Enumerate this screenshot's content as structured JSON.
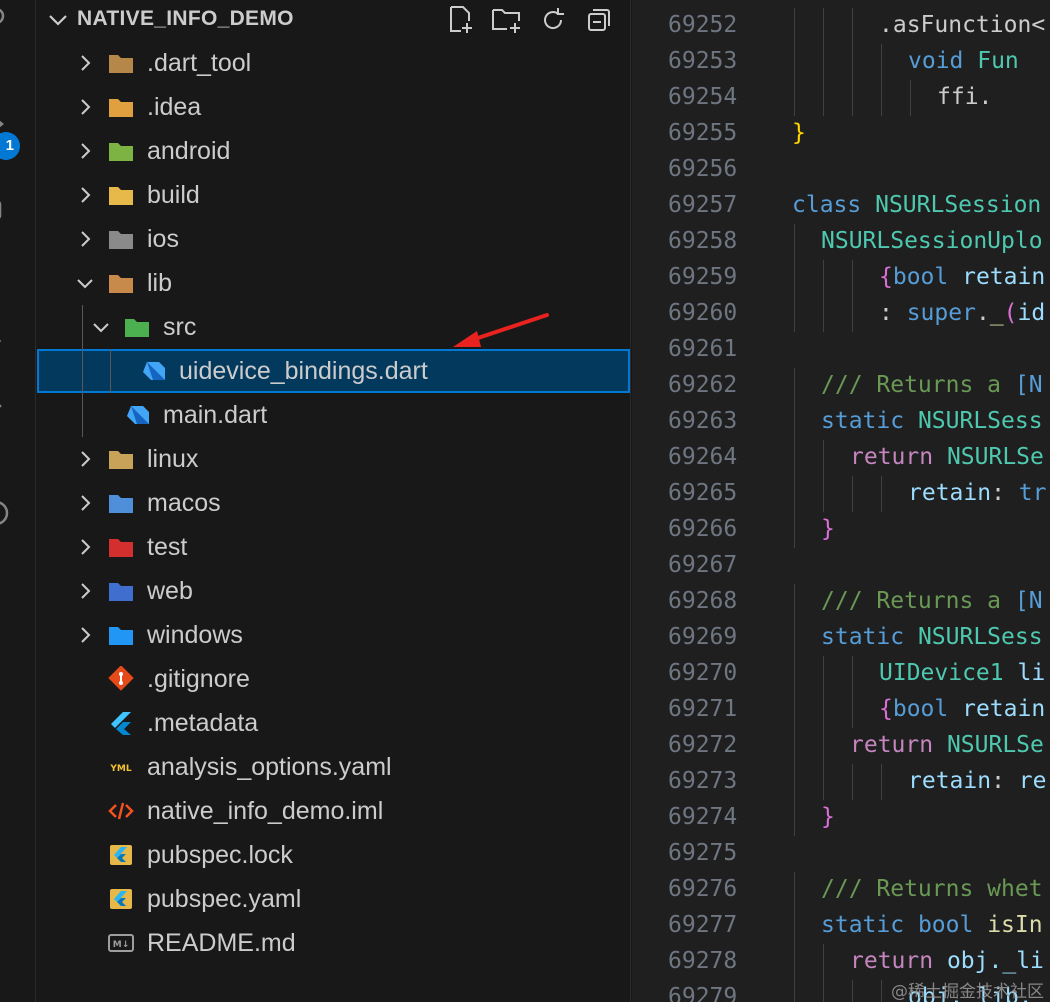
{
  "explorer": {
    "title": "NATIVE_INFO_DEMO",
    "actions": [
      "new-file-icon",
      "new-folder-icon",
      "refresh-icon",
      "collapse-all-icon"
    ],
    "items": [
      {
        "label": ".dart_tool",
        "type": "folder",
        "depth": 0,
        "expanded": false,
        "icon": "folder-icon",
        "color": "#b5884a"
      },
      {
        "label": ".idea",
        "type": "folder",
        "depth": 0,
        "expanded": false,
        "icon": "idea-folder-icon",
        "color": "#e0a040"
      },
      {
        "label": "android",
        "type": "folder",
        "depth": 0,
        "expanded": false,
        "icon": "android-folder-icon",
        "color": "#7cb342"
      },
      {
        "label": "build",
        "type": "folder",
        "depth": 0,
        "expanded": false,
        "icon": "build-folder-icon",
        "color": "#e6b84a"
      },
      {
        "label": "ios",
        "type": "folder",
        "depth": 0,
        "expanded": false,
        "icon": "ios-folder-icon",
        "color": "#8a8a8a"
      },
      {
        "label": "lib",
        "type": "folder",
        "depth": 0,
        "expanded": true,
        "icon": "lib-folder-icon",
        "color": "#c78a4a"
      },
      {
        "label": "src",
        "type": "folder",
        "depth": 1,
        "expanded": true,
        "icon": "src-folder-icon",
        "color": "#4caf50"
      },
      {
        "label": "uidevice_bindings.dart",
        "type": "file",
        "depth": 2,
        "selected": true,
        "icon": "dart-file-icon",
        "color": "#42a5f5"
      },
      {
        "label": "main.dart",
        "type": "file",
        "depth": 1,
        "icon": "dart-file-icon",
        "color": "#42a5f5"
      },
      {
        "label": "linux",
        "type": "folder",
        "depth": 0,
        "expanded": false,
        "icon": "linux-folder-icon",
        "color": "#c9a25a"
      },
      {
        "label": "macos",
        "type": "folder",
        "depth": 0,
        "expanded": false,
        "icon": "macos-folder-icon",
        "color": "#4f8fd9"
      },
      {
        "label": "test",
        "type": "folder",
        "depth": 0,
        "expanded": false,
        "icon": "test-folder-icon",
        "color": "#d32f2f"
      },
      {
        "label": "web",
        "type": "folder",
        "depth": 0,
        "expanded": false,
        "icon": "web-folder-icon",
        "color": "#3f6fcf"
      },
      {
        "label": "windows",
        "type": "folder",
        "depth": 0,
        "expanded": false,
        "icon": "windows-folder-icon",
        "color": "#2196f3"
      },
      {
        "label": ".gitignore",
        "type": "file",
        "depth": 0,
        "icon": "git-icon",
        "color": "#e64a19"
      },
      {
        "label": ".metadata",
        "type": "file",
        "depth": 0,
        "icon": "flutter-icon",
        "color": "#40c4ff"
      },
      {
        "label": "analysis_options.yaml",
        "type": "file",
        "depth": 0,
        "icon": "yaml-icon",
        "color": "#f4c430"
      },
      {
        "label": "native_info_demo.iml",
        "type": "file",
        "depth": 0,
        "icon": "xml-icon",
        "color": "#f4511e"
      },
      {
        "label": "pubspec.lock",
        "type": "file",
        "depth": 0,
        "icon": "pubspec-icon",
        "color": "#e6b84a"
      },
      {
        "label": "pubspec.yaml",
        "type": "file",
        "depth": 0,
        "icon": "pubspec-icon",
        "color": "#e6b84a"
      },
      {
        "label": "README.md",
        "type": "file",
        "depth": 0,
        "icon": "markdown-icon",
        "color": "#9e9e9e"
      }
    ]
  },
  "activity": {
    "badge": "1"
  },
  "editor": {
    "lines": [
      {
        "n": "69252",
        "indent": 3,
        "tokens": [
          [
            ".asFunction<",
            "#cccccc"
          ]
        ]
      },
      {
        "n": "69253",
        "indent": 4,
        "tokens": [
          [
            "void",
            "#569cd6"
          ],
          [
            " Fun",
            "#4ec9b0"
          ]
        ]
      },
      {
        "n": "69254",
        "indent": 5,
        "tokens": [
          [
            "ffi.",
            "#cccccc"
          ]
        ]
      },
      {
        "n": "69255",
        "indent": 0,
        "tokens": [
          [
            "}",
            "#ffd700"
          ]
        ]
      },
      {
        "n": "69256",
        "indent": 0,
        "tokens": []
      },
      {
        "n": "69257",
        "indent": 0,
        "tokens": [
          [
            "class",
            "#569cd6"
          ],
          [
            " NSURLSession",
            "#4ec9b0"
          ]
        ]
      },
      {
        "n": "69258",
        "indent": 1,
        "tokens": [
          [
            "NSURLSessionUplo",
            "#4ec9b0"
          ]
        ]
      },
      {
        "n": "69259",
        "indent": 3,
        "tokens": [
          [
            "{",
            "#da70d6"
          ],
          [
            "bool",
            "#569cd6"
          ],
          [
            " retain",
            "#9cdcfe"
          ]
        ]
      },
      {
        "n": "69260",
        "indent": 3,
        "tokens": [
          [
            ": ",
            "#cccccc"
          ],
          [
            "super",
            "#569cd6"
          ],
          [
            ".",
            "#cccccc"
          ],
          [
            "_",
            "#dcdcaa"
          ],
          [
            "(",
            "#da70d6"
          ],
          [
            "id",
            "#9cdcfe"
          ]
        ]
      },
      {
        "n": "69261",
        "indent": 0,
        "tokens": []
      },
      {
        "n": "69262",
        "indent": 1,
        "tokens": [
          [
            "/// Returns a ",
            "#6a9955"
          ],
          [
            "[N",
            "#569cd6"
          ]
        ]
      },
      {
        "n": "69263",
        "indent": 1,
        "tokens": [
          [
            "static",
            "#569cd6"
          ],
          [
            " NSURLSess",
            "#4ec9b0"
          ]
        ]
      },
      {
        "n": "69264",
        "indent": 2,
        "tokens": [
          [
            "return",
            "#c586c0"
          ],
          [
            " NSURLSe",
            "#4ec9b0"
          ]
        ]
      },
      {
        "n": "69265",
        "indent": 4,
        "tokens": [
          [
            "retain",
            "#9cdcfe"
          ],
          [
            ": ",
            "#cccccc"
          ],
          [
            "tr",
            "#569cd6"
          ]
        ]
      },
      {
        "n": "69266",
        "indent": 1,
        "tokens": [
          [
            "}",
            "#da70d6"
          ]
        ]
      },
      {
        "n": "69267",
        "indent": 0,
        "tokens": []
      },
      {
        "n": "69268",
        "indent": 1,
        "tokens": [
          [
            "/// Returns a ",
            "#6a9955"
          ],
          [
            "[N",
            "#569cd6"
          ]
        ]
      },
      {
        "n": "69269",
        "indent": 1,
        "tokens": [
          [
            "static",
            "#569cd6"
          ],
          [
            " NSURLSess",
            "#4ec9b0"
          ]
        ]
      },
      {
        "n": "69270",
        "indent": 3,
        "tokens": [
          [
            "UIDevice1",
            "#4ec9b0"
          ],
          [
            " li",
            "#9cdcfe"
          ]
        ]
      },
      {
        "n": "69271",
        "indent": 3,
        "tokens": [
          [
            "{",
            "#da70d6"
          ],
          [
            "bool",
            "#569cd6"
          ],
          [
            " retain",
            "#9cdcfe"
          ]
        ]
      },
      {
        "n": "69272",
        "indent": 2,
        "tokens": [
          [
            "return",
            "#c586c0"
          ],
          [
            " NSURLSe",
            "#4ec9b0"
          ]
        ]
      },
      {
        "n": "69273",
        "indent": 4,
        "tokens": [
          [
            "retain",
            "#9cdcfe"
          ],
          [
            ": ",
            "#cccccc"
          ],
          [
            "re",
            "#9cdcfe"
          ]
        ]
      },
      {
        "n": "69274",
        "indent": 1,
        "tokens": [
          [
            "}",
            "#da70d6"
          ]
        ]
      },
      {
        "n": "69275",
        "indent": 0,
        "tokens": []
      },
      {
        "n": "69276",
        "indent": 1,
        "tokens": [
          [
            "/// Returns whet",
            "#6a9955"
          ]
        ]
      },
      {
        "n": "69277",
        "indent": 1,
        "tokens": [
          [
            "static",
            "#569cd6"
          ],
          [
            " bool",
            "#569cd6"
          ],
          [
            " isIn",
            "#dcdcaa"
          ]
        ]
      },
      {
        "n": "69278",
        "indent": 2,
        "tokens": [
          [
            "return",
            "#c586c0"
          ],
          [
            " obj.",
            "#9cdcfe"
          ],
          [
            "_li",
            "#9cdcfe"
          ]
        ]
      },
      {
        "n": "69279",
        "indent": 4,
        "tokens": [
          [
            "obj._lib.",
            "#9cdcfe"
          ]
        ]
      }
    ]
  },
  "watermark": "@稀土掘金技术社区"
}
